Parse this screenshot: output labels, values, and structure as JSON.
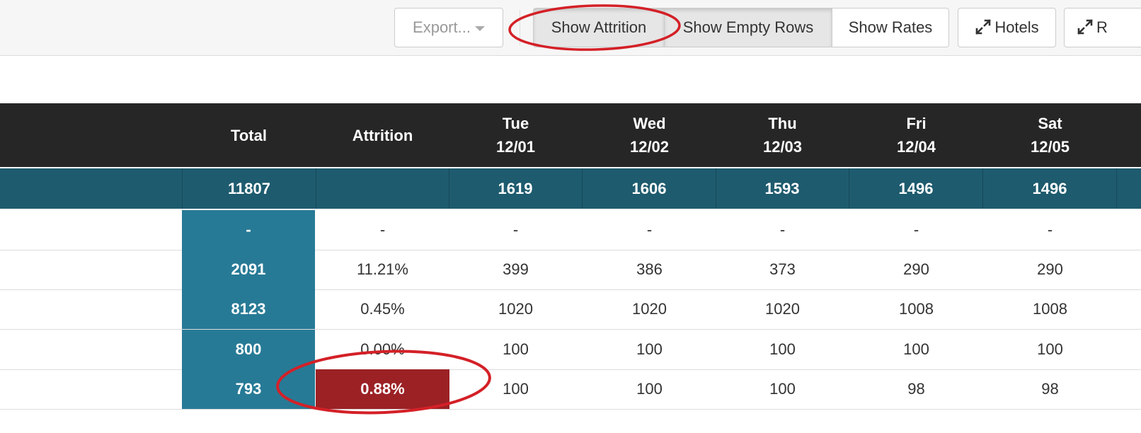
{
  "toolbar": {
    "export_label": "Export...",
    "attrition_label": "Show Attrition",
    "empty_rows_label": "Show Empty Rows",
    "rates_label": "Show Rates",
    "hotels_label": "Hotels",
    "r_label": "R"
  },
  "table": {
    "columns": {
      "total": "Total",
      "attrition": "Attrition",
      "days": [
        {
          "dow": "Tue",
          "date": "12/01"
        },
        {
          "dow": "Wed",
          "date": "12/02"
        },
        {
          "dow": "Thu",
          "date": "12/03"
        },
        {
          "dow": "Fri",
          "date": "12/04"
        },
        {
          "dow": "Sat",
          "date": "12/05"
        }
      ]
    },
    "totals_row": {
      "total": "11807",
      "attrition": "",
      "days": [
        "1619",
        "1606",
        "1593",
        "1496",
        "1496"
      ]
    },
    "rows": [
      {
        "total": "-",
        "attrition": "-",
        "days": [
          "-",
          "-",
          "-",
          "-",
          "-"
        ]
      },
      {
        "total": "2091",
        "attrition": "11.21%",
        "days": [
          "399",
          "386",
          "373",
          "290",
          "290"
        ]
      },
      {
        "total": "8123",
        "attrition": "0.45%",
        "days": [
          "1020",
          "1020",
          "1020",
          "1008",
          "1008"
        ]
      },
      {
        "total": "800",
        "attrition": "0.00%",
        "days": [
          "100",
          "100",
          "100",
          "100",
          "100"
        ]
      },
      {
        "total": "793",
        "attrition": "0.88%",
        "days": [
          "100",
          "100",
          "100",
          "98",
          "98"
        ],
        "attrition_highlight": true
      }
    ]
  },
  "colors": {
    "header_bg": "#262626",
    "totals_bg": "#1e5b6e",
    "total_col_bg": "#277a96",
    "highlight_bg": "#9b2125",
    "annotation": "#d42027"
  }
}
